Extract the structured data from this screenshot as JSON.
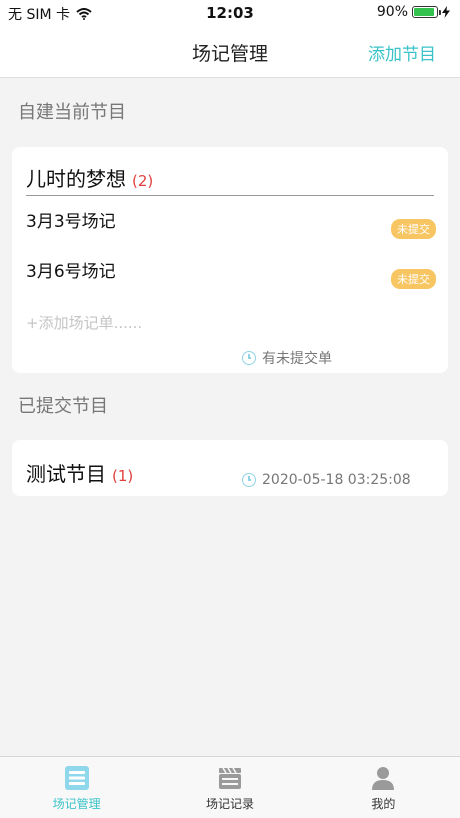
{
  "status_bar": {
    "carrier": "无 SIM 卡",
    "time": "12:03",
    "battery_percent": "90%",
    "battery_level": 0.9,
    "wifi_icon": "wifi-icon"
  },
  "nav": {
    "title": "场记管理",
    "action": "添加节目"
  },
  "sections": {
    "current_title": "自建当前节目",
    "submitted_title": "已提交节目"
  },
  "current_program": {
    "title": "儿时的梦想",
    "count": "(2)",
    "entries": [
      {
        "label": "3月3号场记",
        "badge": "未提交"
      },
      {
        "label": "3月6号场记",
        "badge": "未提交"
      }
    ],
    "add_placeholder": "+添加场记单......",
    "status": "有未提交单"
  },
  "submitted_program": {
    "title": "测试节目",
    "count": "(1)",
    "timestamp": "2020-05-18 03:25:08"
  },
  "tabs": [
    {
      "label": "场记管理",
      "icon": "list-icon",
      "active": true
    },
    {
      "label": "场记记录",
      "icon": "clapperboard-icon",
      "active": false
    },
    {
      "label": "我的",
      "icon": "person-icon",
      "active": false
    }
  ],
  "colors": {
    "accent": "#39c3c9",
    "badge": "#f7c662",
    "count": "#e0413f"
  }
}
